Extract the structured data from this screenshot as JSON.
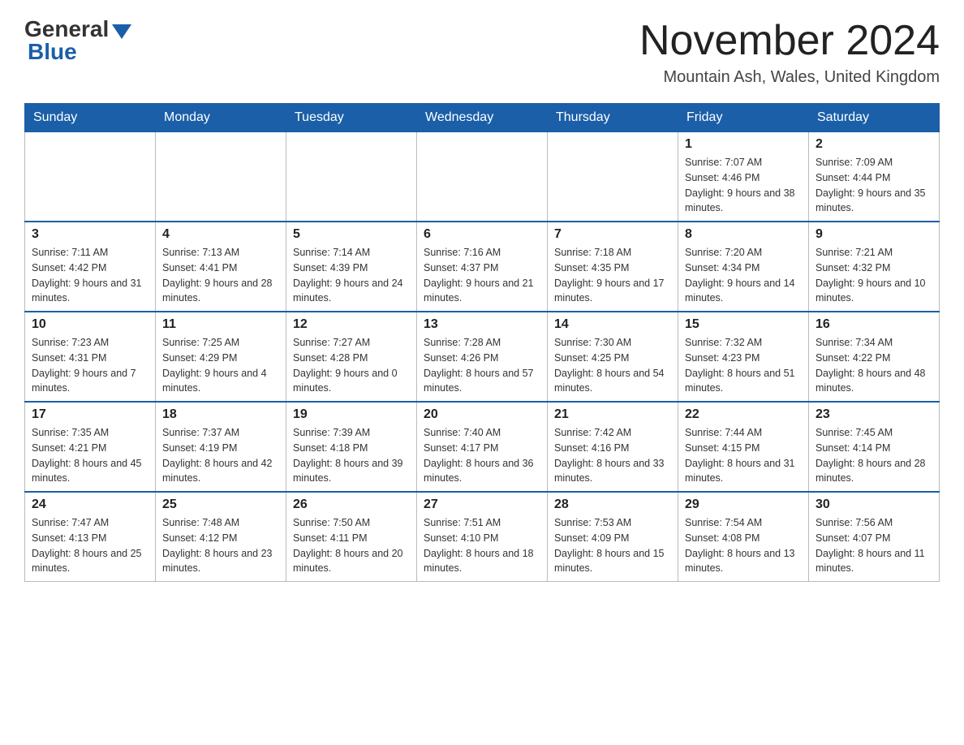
{
  "header": {
    "logo_general": "General",
    "logo_blue": "Blue",
    "month_title": "November 2024",
    "location": "Mountain Ash, Wales, United Kingdom"
  },
  "weekdays": [
    "Sunday",
    "Monday",
    "Tuesday",
    "Wednesday",
    "Thursday",
    "Friday",
    "Saturday"
  ],
  "weeks": [
    [
      {
        "day": "",
        "sunrise": "",
        "sunset": "",
        "daylight": ""
      },
      {
        "day": "",
        "sunrise": "",
        "sunset": "",
        "daylight": ""
      },
      {
        "day": "",
        "sunrise": "",
        "sunset": "",
        "daylight": ""
      },
      {
        "day": "",
        "sunrise": "",
        "sunset": "",
        "daylight": ""
      },
      {
        "day": "",
        "sunrise": "",
        "sunset": "",
        "daylight": ""
      },
      {
        "day": "1",
        "sunrise": "Sunrise: 7:07 AM",
        "sunset": "Sunset: 4:46 PM",
        "daylight": "Daylight: 9 hours and 38 minutes."
      },
      {
        "day": "2",
        "sunrise": "Sunrise: 7:09 AM",
        "sunset": "Sunset: 4:44 PM",
        "daylight": "Daylight: 9 hours and 35 minutes."
      }
    ],
    [
      {
        "day": "3",
        "sunrise": "Sunrise: 7:11 AM",
        "sunset": "Sunset: 4:42 PM",
        "daylight": "Daylight: 9 hours and 31 minutes."
      },
      {
        "day": "4",
        "sunrise": "Sunrise: 7:13 AM",
        "sunset": "Sunset: 4:41 PM",
        "daylight": "Daylight: 9 hours and 28 minutes."
      },
      {
        "day": "5",
        "sunrise": "Sunrise: 7:14 AM",
        "sunset": "Sunset: 4:39 PM",
        "daylight": "Daylight: 9 hours and 24 minutes."
      },
      {
        "day": "6",
        "sunrise": "Sunrise: 7:16 AM",
        "sunset": "Sunset: 4:37 PM",
        "daylight": "Daylight: 9 hours and 21 minutes."
      },
      {
        "day": "7",
        "sunrise": "Sunrise: 7:18 AM",
        "sunset": "Sunset: 4:35 PM",
        "daylight": "Daylight: 9 hours and 17 minutes."
      },
      {
        "day": "8",
        "sunrise": "Sunrise: 7:20 AM",
        "sunset": "Sunset: 4:34 PM",
        "daylight": "Daylight: 9 hours and 14 minutes."
      },
      {
        "day": "9",
        "sunrise": "Sunrise: 7:21 AM",
        "sunset": "Sunset: 4:32 PM",
        "daylight": "Daylight: 9 hours and 10 minutes."
      }
    ],
    [
      {
        "day": "10",
        "sunrise": "Sunrise: 7:23 AM",
        "sunset": "Sunset: 4:31 PM",
        "daylight": "Daylight: 9 hours and 7 minutes."
      },
      {
        "day": "11",
        "sunrise": "Sunrise: 7:25 AM",
        "sunset": "Sunset: 4:29 PM",
        "daylight": "Daylight: 9 hours and 4 minutes."
      },
      {
        "day": "12",
        "sunrise": "Sunrise: 7:27 AM",
        "sunset": "Sunset: 4:28 PM",
        "daylight": "Daylight: 9 hours and 0 minutes."
      },
      {
        "day": "13",
        "sunrise": "Sunrise: 7:28 AM",
        "sunset": "Sunset: 4:26 PM",
        "daylight": "Daylight: 8 hours and 57 minutes."
      },
      {
        "day": "14",
        "sunrise": "Sunrise: 7:30 AM",
        "sunset": "Sunset: 4:25 PM",
        "daylight": "Daylight: 8 hours and 54 minutes."
      },
      {
        "day": "15",
        "sunrise": "Sunrise: 7:32 AM",
        "sunset": "Sunset: 4:23 PM",
        "daylight": "Daylight: 8 hours and 51 minutes."
      },
      {
        "day": "16",
        "sunrise": "Sunrise: 7:34 AM",
        "sunset": "Sunset: 4:22 PM",
        "daylight": "Daylight: 8 hours and 48 minutes."
      }
    ],
    [
      {
        "day": "17",
        "sunrise": "Sunrise: 7:35 AM",
        "sunset": "Sunset: 4:21 PM",
        "daylight": "Daylight: 8 hours and 45 minutes."
      },
      {
        "day": "18",
        "sunrise": "Sunrise: 7:37 AM",
        "sunset": "Sunset: 4:19 PM",
        "daylight": "Daylight: 8 hours and 42 minutes."
      },
      {
        "day": "19",
        "sunrise": "Sunrise: 7:39 AM",
        "sunset": "Sunset: 4:18 PM",
        "daylight": "Daylight: 8 hours and 39 minutes."
      },
      {
        "day": "20",
        "sunrise": "Sunrise: 7:40 AM",
        "sunset": "Sunset: 4:17 PM",
        "daylight": "Daylight: 8 hours and 36 minutes."
      },
      {
        "day": "21",
        "sunrise": "Sunrise: 7:42 AM",
        "sunset": "Sunset: 4:16 PM",
        "daylight": "Daylight: 8 hours and 33 minutes."
      },
      {
        "day": "22",
        "sunrise": "Sunrise: 7:44 AM",
        "sunset": "Sunset: 4:15 PM",
        "daylight": "Daylight: 8 hours and 31 minutes."
      },
      {
        "day": "23",
        "sunrise": "Sunrise: 7:45 AM",
        "sunset": "Sunset: 4:14 PM",
        "daylight": "Daylight: 8 hours and 28 minutes."
      }
    ],
    [
      {
        "day": "24",
        "sunrise": "Sunrise: 7:47 AM",
        "sunset": "Sunset: 4:13 PM",
        "daylight": "Daylight: 8 hours and 25 minutes."
      },
      {
        "day": "25",
        "sunrise": "Sunrise: 7:48 AM",
        "sunset": "Sunset: 4:12 PM",
        "daylight": "Daylight: 8 hours and 23 minutes."
      },
      {
        "day": "26",
        "sunrise": "Sunrise: 7:50 AM",
        "sunset": "Sunset: 4:11 PM",
        "daylight": "Daylight: 8 hours and 20 minutes."
      },
      {
        "day": "27",
        "sunrise": "Sunrise: 7:51 AM",
        "sunset": "Sunset: 4:10 PM",
        "daylight": "Daylight: 8 hours and 18 minutes."
      },
      {
        "day": "28",
        "sunrise": "Sunrise: 7:53 AM",
        "sunset": "Sunset: 4:09 PM",
        "daylight": "Daylight: 8 hours and 15 minutes."
      },
      {
        "day": "29",
        "sunrise": "Sunrise: 7:54 AM",
        "sunset": "Sunset: 4:08 PM",
        "daylight": "Daylight: 8 hours and 13 minutes."
      },
      {
        "day": "30",
        "sunrise": "Sunrise: 7:56 AM",
        "sunset": "Sunset: 4:07 PM",
        "daylight": "Daylight: 8 hours and 11 minutes."
      }
    ]
  ]
}
